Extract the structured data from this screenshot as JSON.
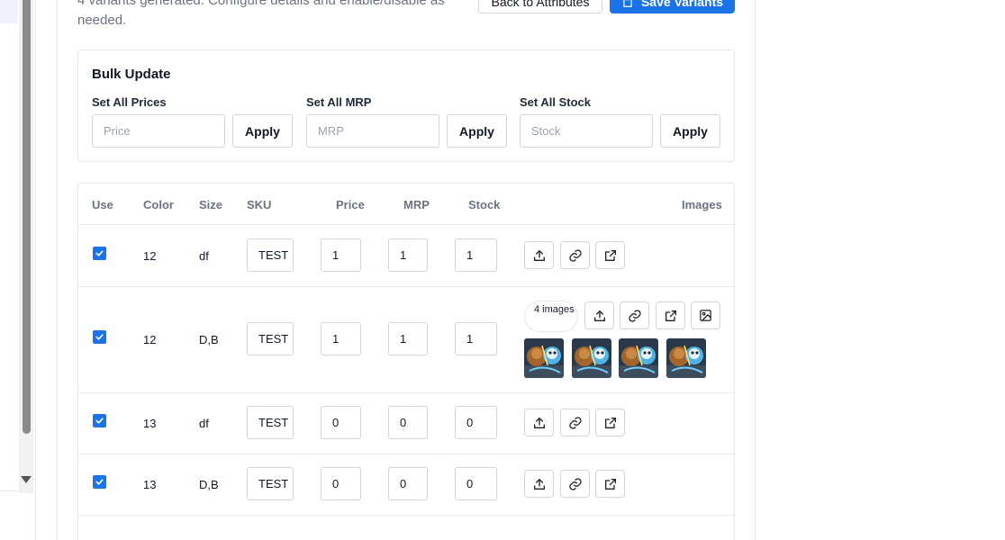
{
  "header": {
    "subtitle": "4 variants generated. Configure details and enable/disable as needed.",
    "back_label": "Back to Attributes",
    "save_label": "Save Variants"
  },
  "bulk": {
    "title": "Bulk Update",
    "groups": [
      {
        "label": "Set All Prices",
        "placeholder": "Price",
        "apply": "Apply"
      },
      {
        "label": "Set All MRP",
        "placeholder": "MRP",
        "apply": "Apply"
      },
      {
        "label": "Set All Stock",
        "placeholder": "Stock",
        "apply": "Apply"
      }
    ]
  },
  "table": {
    "headers": {
      "use": "Use",
      "color": "Color",
      "size": "Size",
      "sku": "SKU",
      "price": "Price",
      "mrp": "MRP",
      "stock": "Stock",
      "images": "Images"
    },
    "rows": [
      {
        "checked": true,
        "color": "12",
        "size": "df",
        "sku": "TEST",
        "price": "1",
        "mrp": "1",
        "stock": "1"
      },
      {
        "checked": true,
        "color": "12",
        "size": "D,B",
        "sku": "TEST",
        "price": "1",
        "mrp": "1",
        "stock": "1",
        "images_badge": "4 images",
        "thumb_count": 4
      },
      {
        "checked": true,
        "color": "13",
        "size": "df",
        "sku": "TEST",
        "price": "0",
        "mrp": "0",
        "stock": "0"
      },
      {
        "checked": true,
        "color": "13",
        "size": "D,B",
        "sku": "TEST",
        "price": "0",
        "mrp": "0",
        "stock": "0"
      }
    ],
    "icons": [
      "upload-icon",
      "link-icon",
      "external-link-icon",
      "image-icon"
    ]
  },
  "colors": {
    "accent": "#1a73e8",
    "border": "#e5e7eb",
    "muted": "#6b7280"
  }
}
